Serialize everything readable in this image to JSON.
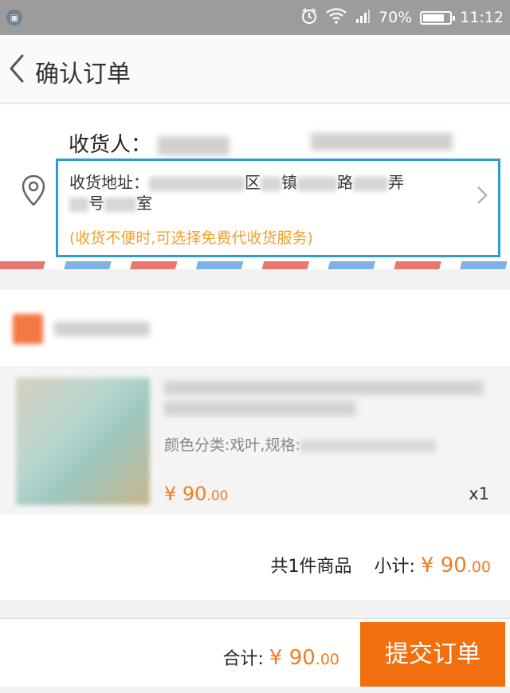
{
  "status_bar": {
    "battery": "70%",
    "battery_level": 0.7,
    "time": "11:12",
    "icons": [
      "app-icon",
      "alarm-icon",
      "wifi-icon",
      "signal-icon",
      "battery-icon"
    ]
  },
  "header": {
    "title": "确认订单"
  },
  "address": {
    "recipient_label": "收货人：",
    "address_label": "收货地址：",
    "address_parts": [
      "区",
      "镇",
      "路",
      "弄",
      "号",
      "室"
    ],
    "note": "(收货不便时,可选择免费代收货服务)"
  },
  "product": {
    "spec_label": "颜色分类:戏叶,规格:",
    "price_main": "¥ 90",
    "price_decimal": ".00",
    "quantity": "x1"
  },
  "subtotal": {
    "count_text": "共1件商品",
    "label": "小计:",
    "price_main": "¥ 90",
    "price_decimal": ".00"
  },
  "bottom_bar": {
    "total_label": "合计:",
    "price_main": "¥ 90",
    "price_decimal": ".00",
    "submit_label": "提交订单"
  },
  "colors": {
    "accent_orange": "#f27c21",
    "submit_bg": "#f26f0e",
    "highlight_border": "#2f9ad8",
    "note_color": "#f0a02c"
  }
}
